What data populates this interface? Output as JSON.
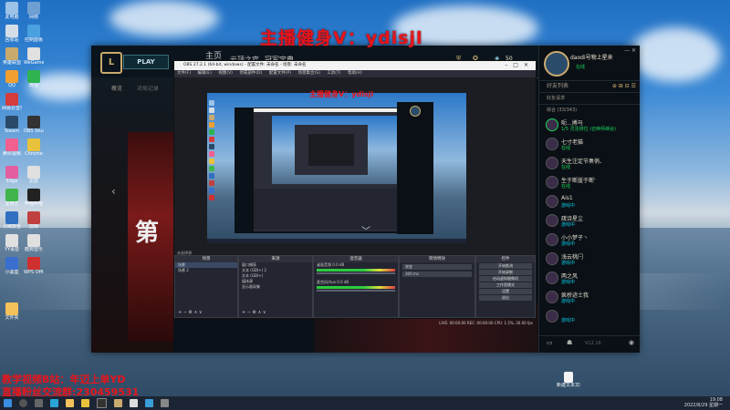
{
  "overlay": {
    "top_text": "主播健身V：ydisjl",
    "bottom_line1": "教学视频B站：年迈上单YD",
    "bottom_line2": "直播粉丝交流群:230459531",
    "color": "#e8151b"
  },
  "lol_client": {
    "play_label": "PLAY",
    "nav_left": "主页",
    "nav_middle": "云顶之弈",
    "nav_right": "冠军宝典",
    "currency": "50",
    "art_label": "第",
    "left_tab1": "概览",
    "left_tab2": "对局记录",
    "chevron_label": "﹀"
  },
  "friends": {
    "user_name": "daodi号物上星来",
    "user_status": "在线",
    "list_title": "好友列表",
    "requests": "好友请求",
    "group": "综合 (33/343)",
    "items": [
      {
        "name": "呃...搏马",
        "status": "1/5 灵活排位 (召唤师峡谷)",
        "kind": "online"
      },
      {
        "name": "七寸老猫",
        "status": "在线",
        "kind": "online"
      },
      {
        "name": "天生注定节奏俏、",
        "status": "在线",
        "kind": "online"
      },
      {
        "name": "生于断崖于断'",
        "status": "在线",
        "kind": "online"
      },
      {
        "name": "Ais1",
        "status": "游戏中",
        "kind": "ingame"
      },
      {
        "name": "疏诗星尘",
        "status": "游戏中",
        "kind": "ingame"
      },
      {
        "name": "小小梦子丶",
        "status": "游戏中",
        "kind": "ingame"
      },
      {
        "name": "浅云桃闩",
        "status": "游戏中",
        "kind": "ingame"
      },
      {
        "name": "两之风",
        "status": "游戏中",
        "kind": "ingame"
      },
      {
        "name": "疯桥迹士我",
        "status": "游戏中",
        "kind": "ingame"
      },
      {
        "name": "",
        "status": "游戏中",
        "kind": "ingame"
      }
    ],
    "footer_version": "V12.16"
  },
  "obs": {
    "title": "OBS 27.2.1 (64-bit, windows) - 配置文件: 未命名 - 场景: 未命名",
    "menu": [
      "文件(F)",
      "编辑(E)",
      "视图(V)",
      "停靠部件(D)",
      "配置文件(P)",
      "场景集合(S)",
      "工具(T)",
      "帮助(H)"
    ],
    "scene_dock": "场景",
    "scenes": [
      "场景",
      "场景 2"
    ],
    "source_dock": "来源",
    "sources": [
      "窗口捕获",
      "文本 (GDI+) 2",
      "文本 (GDI+)",
      "媒体源",
      "显示器采集"
    ],
    "mixer_dock": "混音器",
    "mixer_tracks": [
      "桌面音频 0.0 dB",
      "麦克风/Aux 0.0 dB"
    ],
    "transition_dock": "转场特效",
    "transition_value": "渐变",
    "duration_value": "300 ms",
    "controls_dock": "控件",
    "controls": [
      "开始推流",
      "开始录制",
      "启动虚拟摄像机",
      "工作室模式",
      "设置",
      "退出"
    ],
    "status_bar": "LIVE: 00:00:00  REC: 00:00:00  CPU: 1.5%, 30.00 fps",
    "filter_label": "未选择源"
  },
  "taskbar": {
    "time": "19:08",
    "date": "2022/8/29 星期一"
  },
  "desktop": {
    "icons": [
      "此电脑",
      "网络",
      "回收站",
      "控制面板",
      "英雄联盟",
      "WeGame",
      "QQ",
      "微信",
      "网易云音乐",
      "Steam",
      "OBS Studio",
      "腾讯视频",
      "Chrome",
      "Edge",
      "迅雷",
      "爱奇艺",
      "哔哩哔哩",
      "火绒安全",
      "剪映",
      "YY语音",
      "酷狗音乐",
      "小黑盒",
      "WPS Office",
      "文件夹"
    ],
    "file_icon": "新建文本文档"
  }
}
